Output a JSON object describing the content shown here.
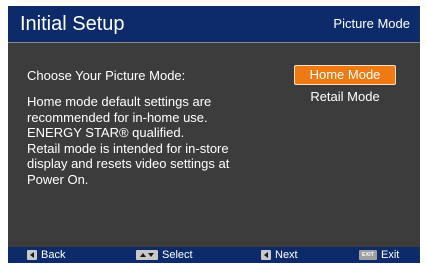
{
  "header": {
    "title": "Initial Setup",
    "subtitle": "Picture Mode"
  },
  "main": {
    "prompt": "Choose Your Picture Mode:",
    "description": "Home mode default settings are\nrecommended for in-home use.\nENERGY STAR® qualified.\nRetail mode is intended for in-store\ndisplay and resets video settings at\nPower On."
  },
  "options": [
    {
      "label": "Home Mode",
      "selected": true
    },
    {
      "label": "Retail Mode",
      "selected": false
    }
  ],
  "footer": {
    "back": {
      "label": "Back",
      "key_icon": "left-arrow-key-icon"
    },
    "select": {
      "label": "Select",
      "key_icon": "up-down-arrow-key-icon"
    },
    "next": {
      "label": "Next",
      "key_icon": "left-arrow-key-icon"
    },
    "exit": {
      "label": "Exit",
      "key_text": "EXIT"
    }
  },
  "colors": {
    "header_bg": "#0d2a6b",
    "body_bg": "#3c3c3c",
    "selected_bg": "#f07a12",
    "text": "#ffffff"
  }
}
